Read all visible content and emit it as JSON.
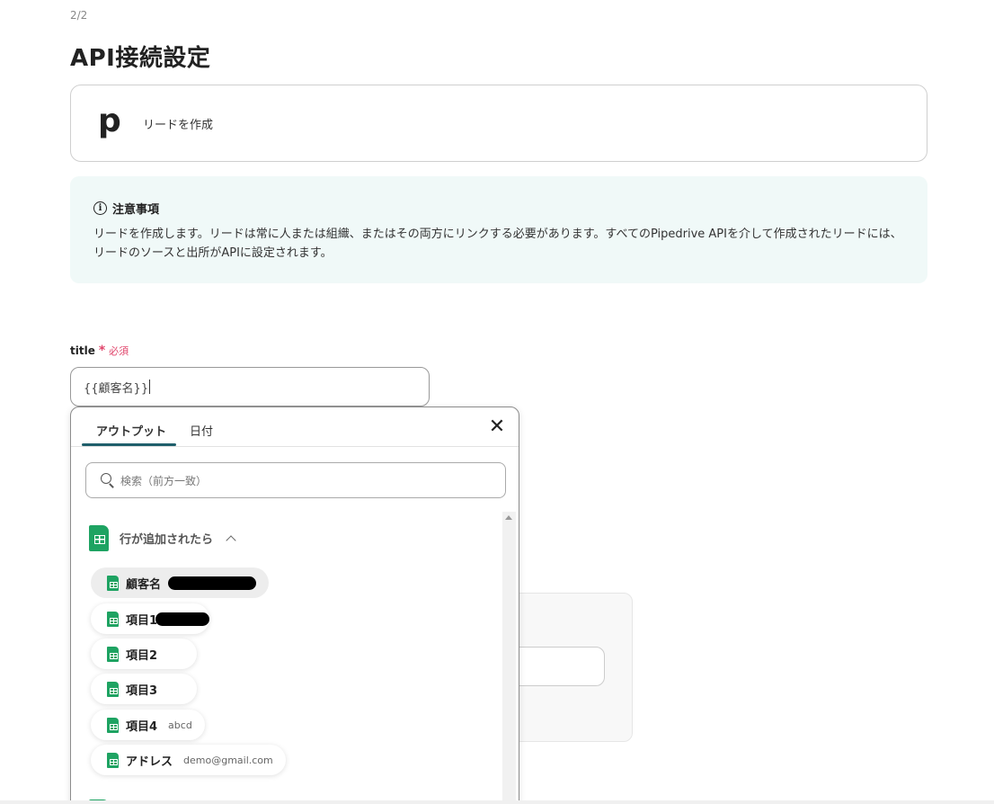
{
  "header": {
    "step": "2/2",
    "title": "API接続設定"
  },
  "app_card": {
    "logo": "p",
    "action": "リードを作成"
  },
  "notice": {
    "title": "注意事項",
    "body": "リードを作成します。リードは常に人または組織、またはその両方にリンクする必要があります。すべてのPipedrive APIを介して作成されたリードには、リードのソースと出所がAPIに設定されます。"
  },
  "field": {
    "label": "title",
    "required_star": "*",
    "required_text": "必須",
    "value": "{{顧客名}}"
  },
  "popup": {
    "tabs": [
      {
        "label": "アウトプット",
        "active": true
      },
      {
        "label": "日付",
        "active": false
      }
    ],
    "close_icon": "close-icon",
    "search_placeholder": "検索（前方一致）",
    "group": {
      "label": "行が追加されたら",
      "icon": "google-sheets-icon",
      "expanded": true
    },
    "items": [
      {
        "label": "顧客名",
        "value": "",
        "redacted": true
      },
      {
        "label": "項目1",
        "value": "",
        "redacted": true
      },
      {
        "label": "項目2",
        "value": ""
      },
      {
        "label": "項目3",
        "value": ""
      },
      {
        "label": "項目4",
        "value": "abcd"
      },
      {
        "label": "アドレス",
        "value": "demo@gmail.com"
      }
    ]
  },
  "colors": {
    "accent": "#1f5f6b",
    "required": "#e0456b",
    "sheets_green": "#1ea362",
    "notice_bg": "#f0f9f8"
  }
}
